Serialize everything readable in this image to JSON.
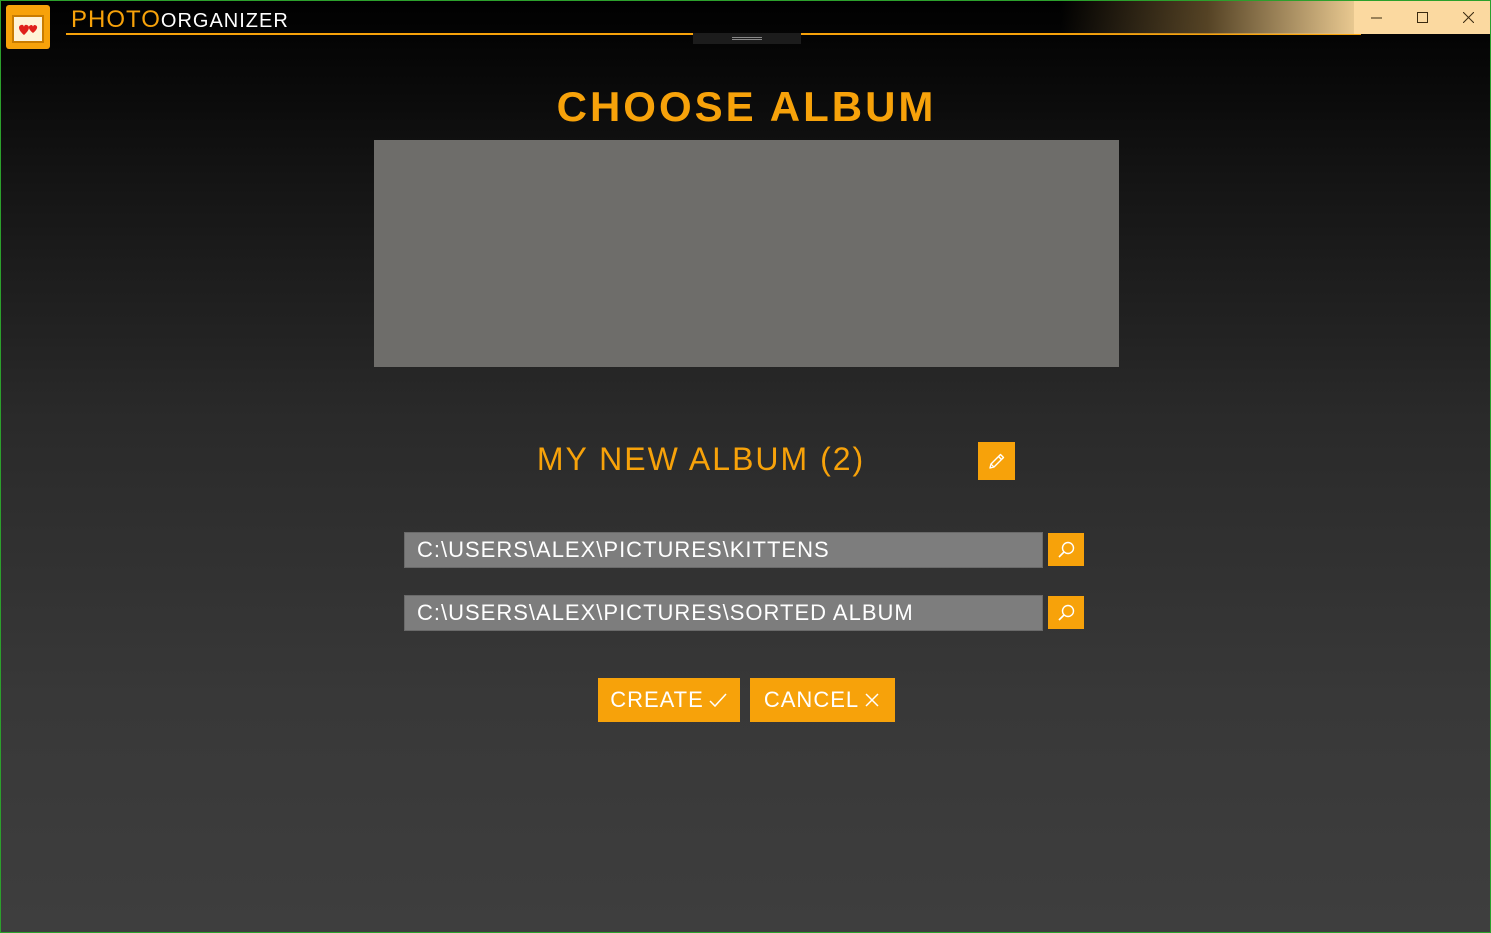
{
  "window": {
    "title_part1": "PHOTO",
    "title_part2": "ORGANIZER",
    "controls": {
      "minimize": "—",
      "maximize": "☐",
      "close": "✕"
    }
  },
  "main": {
    "heading": "CHOOSE ALBUM",
    "album_name": "MY NEW ALBUM (2)",
    "source_path": "C:\\USERS\\ALEX\\PICTURES\\KITTENS",
    "destination_path": "C:\\USERS\\ALEX\\PICTURES\\SORTED ALBUM",
    "create_label": "CREATE",
    "cancel_label": "CANCEL"
  },
  "icons": {
    "edit": "pencil-icon",
    "browse": "search-icon",
    "create": "check-icon",
    "cancel": "close-icon",
    "logo": "photo-hearts-icon"
  },
  "colors": {
    "accent": "#f7a20a",
    "field": "#7d7d7d",
    "preview": "#6e6d6a"
  }
}
